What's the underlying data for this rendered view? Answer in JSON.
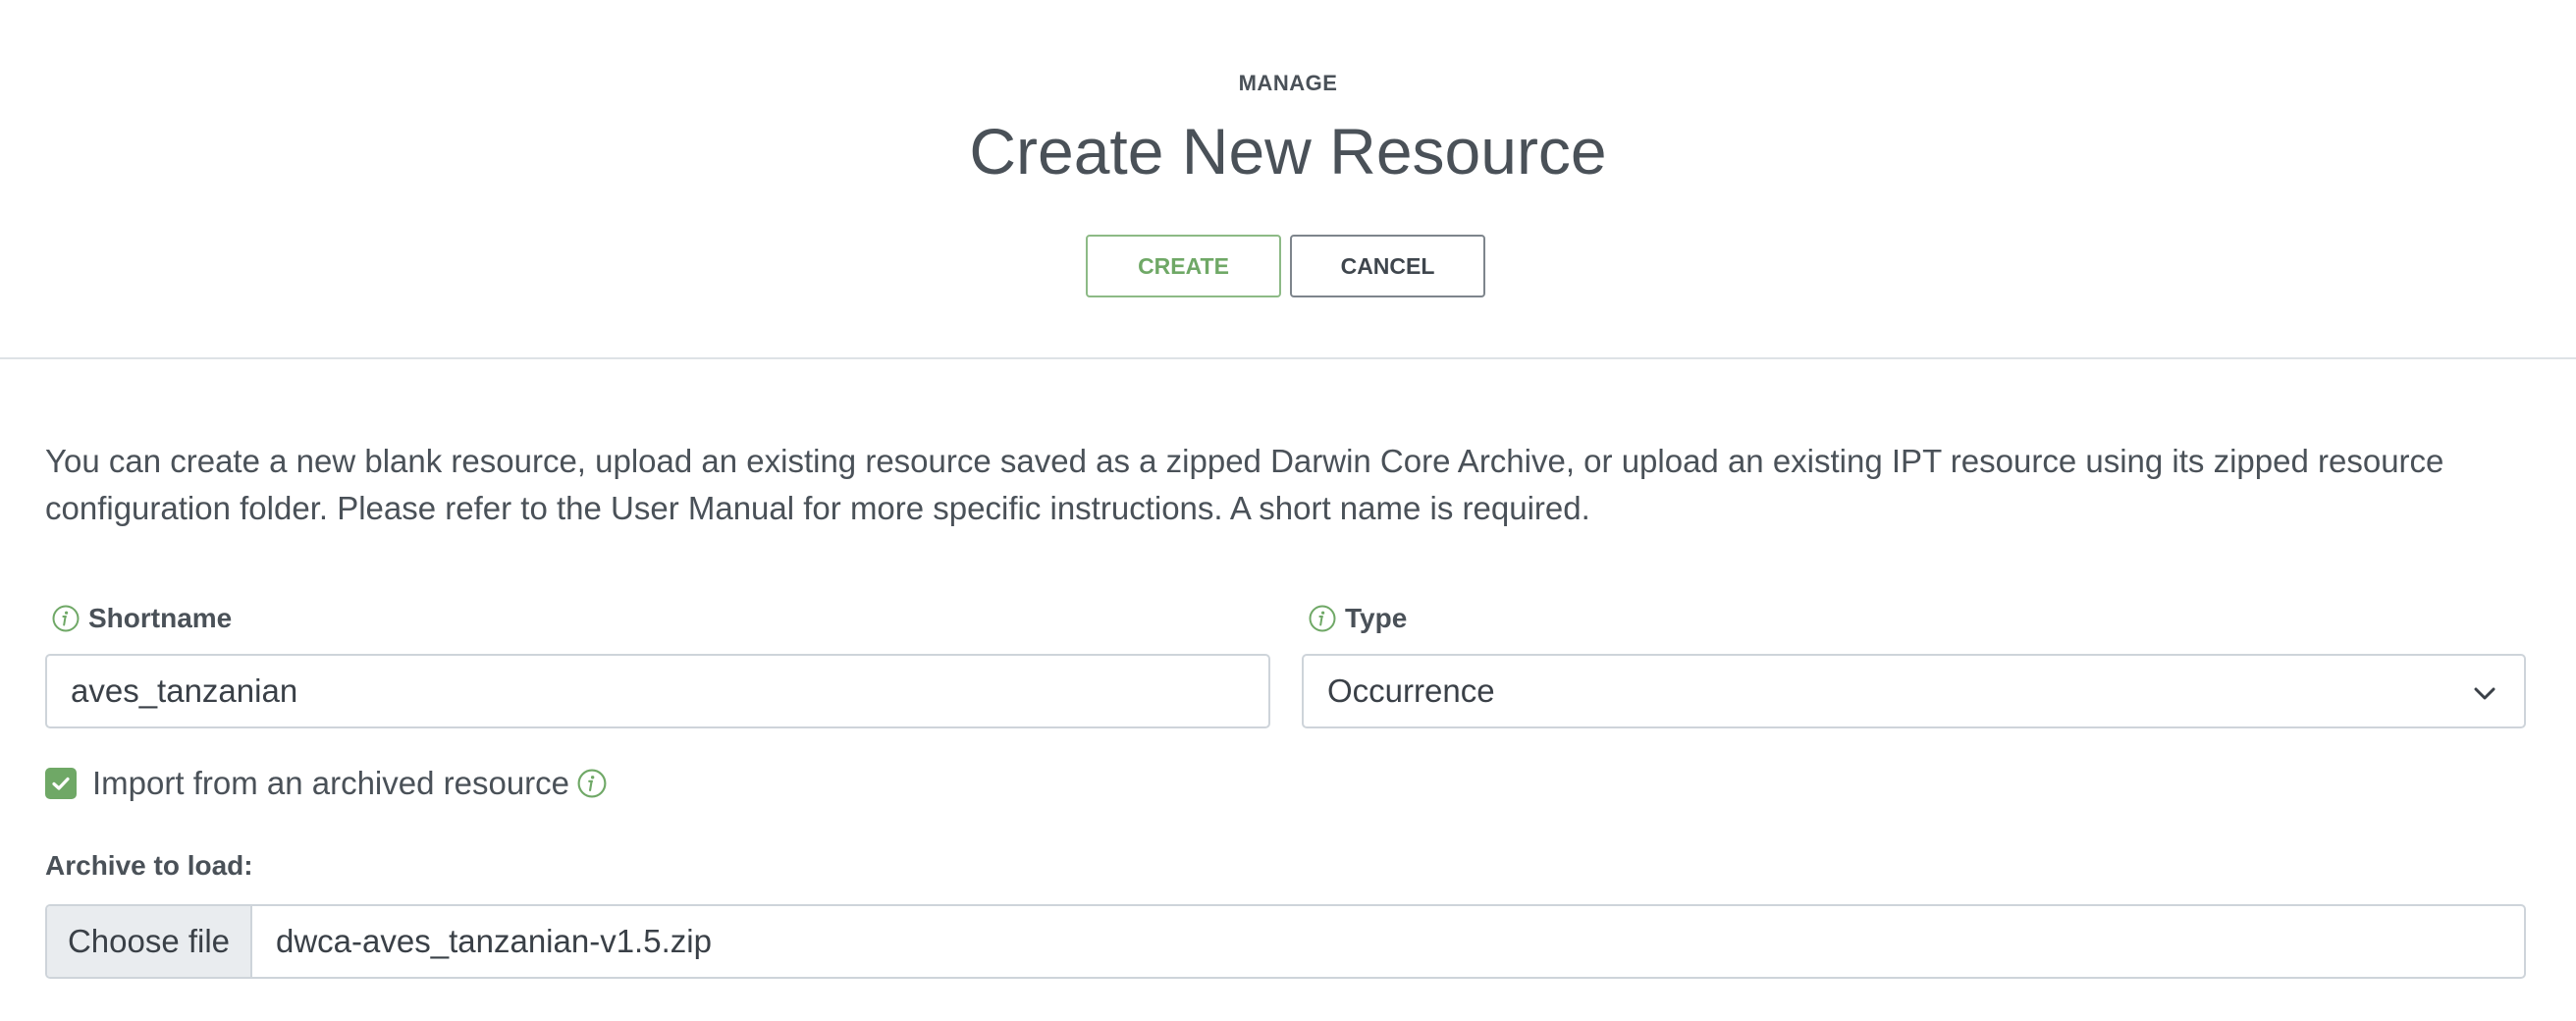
{
  "header": {
    "eyebrow": "MANAGE",
    "title": "Create New Resource",
    "create_label": "CREATE",
    "cancel_label": "CANCEL"
  },
  "intro": "You can create a new blank resource, upload an existing resource saved as a zipped Darwin Core Archive, or upload an existing IPT resource using its zipped resource configuration folder. Please refer to the User Manual for more specific instructions. A short name is required.",
  "form": {
    "shortname": {
      "label": "Shortname",
      "value": "aves_tanzanian",
      "icon": "info-icon"
    },
    "type": {
      "label": "Type",
      "selected": "Occurrence",
      "icon": "info-icon"
    },
    "import": {
      "label": "Import from an archived resource",
      "checked": true
    },
    "archive": {
      "label": "Archive to load:",
      "button_label": "Choose file",
      "file_name": "dwca-aves_tanzanian-v1.5.zip"
    }
  },
  "colors": {
    "accent": "#6fa866",
    "text": "#4a5158",
    "border": "#ced4da"
  }
}
